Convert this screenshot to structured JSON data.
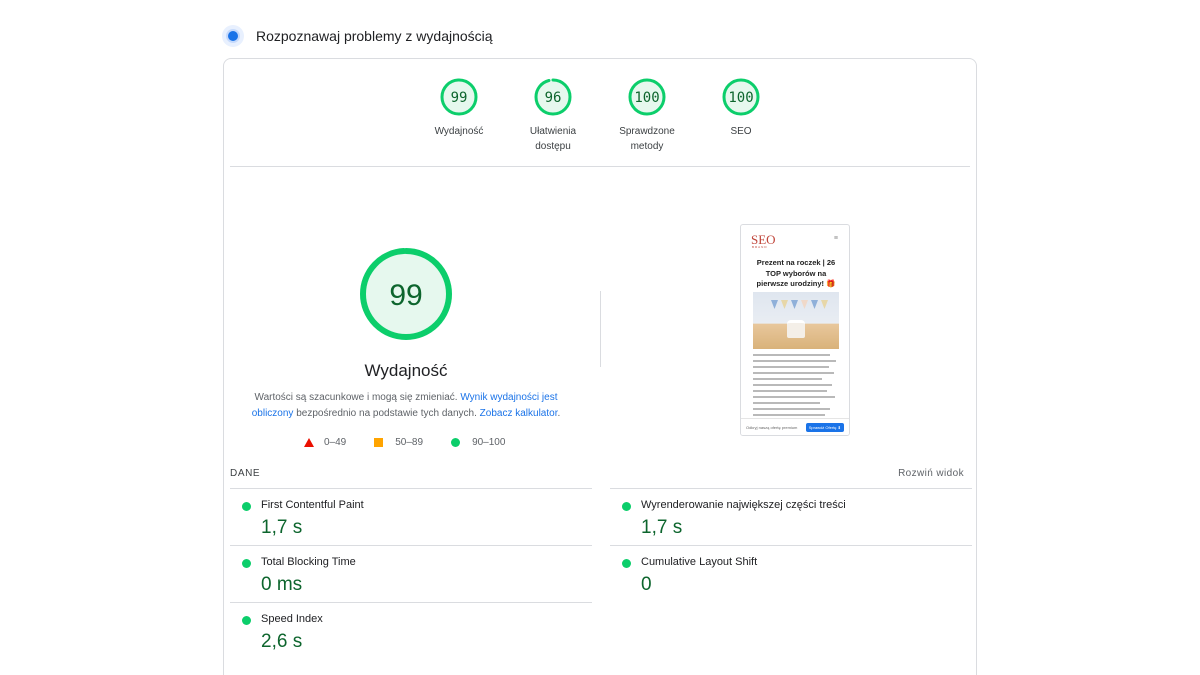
{
  "header": {
    "title": "Rozpoznawaj problemy z wydajnością",
    "icon": "lighthouse-icon"
  },
  "colors": {
    "pass": "#0cce6b",
    "pass_text": "#0d652d",
    "average": "#ffa400",
    "fail": "#eb0f00",
    "link": "#1a73e8"
  },
  "scores": [
    {
      "label": "Wydajność",
      "value": 99
    },
    {
      "label": "Ułatwienia dostępu",
      "value": 96
    },
    {
      "label": "Sprawdzone metody",
      "value": 100
    },
    {
      "label": "SEO",
      "value": 100
    }
  ],
  "performance": {
    "score": 99,
    "title": "Wydajność",
    "desc_part1": "Wartości są szacunkowe i mogą się zmieniać. ",
    "desc_link1": "Wynik wydajności jest obliczony",
    "desc_part2": " bezpośrednio na podstawie tych danych. ",
    "desc_link2": "Zobacz kalkulator",
    "desc_part3": "."
  },
  "legend": [
    {
      "shape": "triangle",
      "range": "0–49"
    },
    {
      "shape": "square",
      "range": "50–89"
    },
    {
      "shape": "circle",
      "range": "90–100"
    }
  ],
  "thumbnail": {
    "logo": "SEO",
    "logo_sub": "BRAND",
    "title": "Prezent na roczek | 26 TOP wyborów na pierwsze urodziny! 🎁",
    "bar_text": "Odkryj naszą ofertę premium",
    "bar_button": "Sprawdź Ofertę ⬇"
  },
  "metrics_section": {
    "label": "DANE",
    "expand": "Rozwiń widok"
  },
  "metrics": [
    {
      "name": "First Contentful Paint",
      "value": "1,7 s"
    },
    {
      "name": "Wyrenderowanie największej części treści",
      "value": "1,7 s"
    },
    {
      "name": "Total Blocking Time",
      "value": "0 ms"
    },
    {
      "name": "Cumulative Layout Shift",
      "value": "0"
    },
    {
      "name": "Speed Index",
      "value": "2,6 s"
    }
  ]
}
